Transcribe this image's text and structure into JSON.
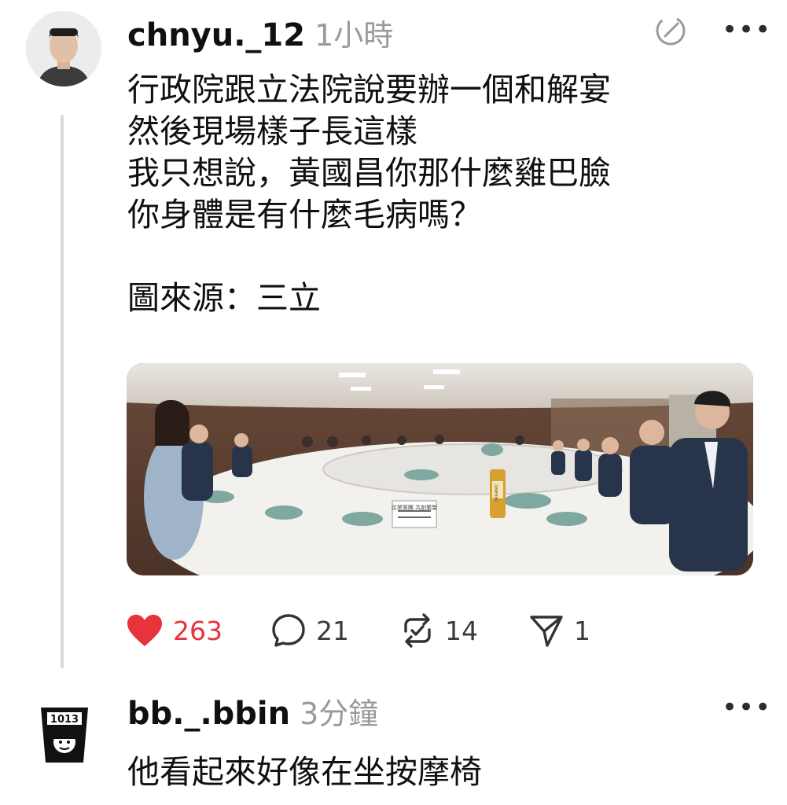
{
  "post": {
    "username": "chnyu._12",
    "timestamp": "1小時",
    "lines": [
      "行政院跟立法院說要辦一個和解宴",
      "然後現場樣子長這樣",
      "我只想說，黃國昌你那什麼雞巴臉",
      "你身體是有什麼毛病嗎？"
    ],
    "source": "圖來源：三立",
    "photo_sign_text": "民眾黨團 共創繁榮",
    "photo_bottle_text": "ORGANIC",
    "actions": {
      "likes": "263",
      "comments": "21",
      "reposts": "14",
      "shares": "1"
    },
    "like_color": "#e8323c"
  },
  "reply": {
    "username": "bb._.bbin",
    "timestamp": "3分鐘",
    "text": "他看起來好像在坐按摩椅",
    "avatar_text": "1013"
  },
  "menu_glyph": "•••",
  "icons": [
    "edit-circle-icon",
    "more-icon",
    "heart-icon",
    "comment-icon",
    "repost-icon",
    "share-icon"
  ]
}
